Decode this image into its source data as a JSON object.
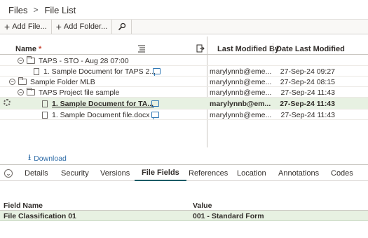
{
  "breadcrumb": {
    "parent": "Files",
    "separator": ">",
    "current": "File List"
  },
  "toolbar": {
    "add_file": "Add File...",
    "add_folder": "Add Folder...",
    "plus_glyph": "+"
  },
  "grid": {
    "columns": {
      "name": "Name",
      "required_marker": "*",
      "last_modified_by": "Last Modified By",
      "date_last_modified": "Date Last Modified"
    },
    "rows": [
      {
        "name": "TAPS - STO - Aug 28 07:00",
        "type": "folder",
        "toggle": "−",
        "last_modified_by": "",
        "date": "",
        "has_comment": false
      },
      {
        "name": "1. Sample Document for TAPS 2...",
        "type": "document",
        "toggle": "",
        "last_modified_by": "marylynnb@eme...",
        "date": "27-Sep-24 09:27",
        "has_comment": true
      },
      {
        "name": "Sample Folder MLB",
        "type": "folder",
        "toggle": "−",
        "last_modified_by": "marylynnb@eme...",
        "date": "27-Sep-24 08:15",
        "has_comment": false
      },
      {
        "name": "TAPS Project file sample",
        "type": "folder",
        "toggle": "−",
        "last_modified_by": "marylynnb@eme...",
        "date": "27-Sep-24 11:43",
        "has_comment": false
      },
      {
        "name": "1. Sample Document for TA...",
        "type": "document",
        "toggle": "",
        "last_modified_by": "marylynnb@em...",
        "date": "27-Sep-24 11:43",
        "has_comment": true,
        "selected": true
      },
      {
        "name": "1. Sample Document file.docx",
        "type": "document",
        "toggle": "",
        "last_modified_by": "marylynnb@eme...",
        "date": "27-Sep-24 11:43",
        "has_comment": true
      }
    ]
  },
  "download": {
    "label": "Download"
  },
  "tabs": {
    "toggle": "⌄",
    "items": [
      {
        "label": "Details"
      },
      {
        "label": "Security"
      },
      {
        "label": "Versions"
      },
      {
        "label": "File Fields",
        "active": true
      },
      {
        "label": "References"
      },
      {
        "label": "Location"
      },
      {
        "label": "Annotations"
      },
      {
        "label": "Codes"
      }
    ]
  },
  "file_fields": {
    "header": {
      "field_name": "Field Name",
      "value": "Value"
    },
    "rows": [
      {
        "field_name": "File Classification 01",
        "value": "001 - Standard Form"
      }
    ]
  },
  "colors": {
    "selected_row": "#e7f1e2",
    "link": "#2f6ca7",
    "required": "#c74634",
    "active_tab_underline": "#1a5b66"
  }
}
